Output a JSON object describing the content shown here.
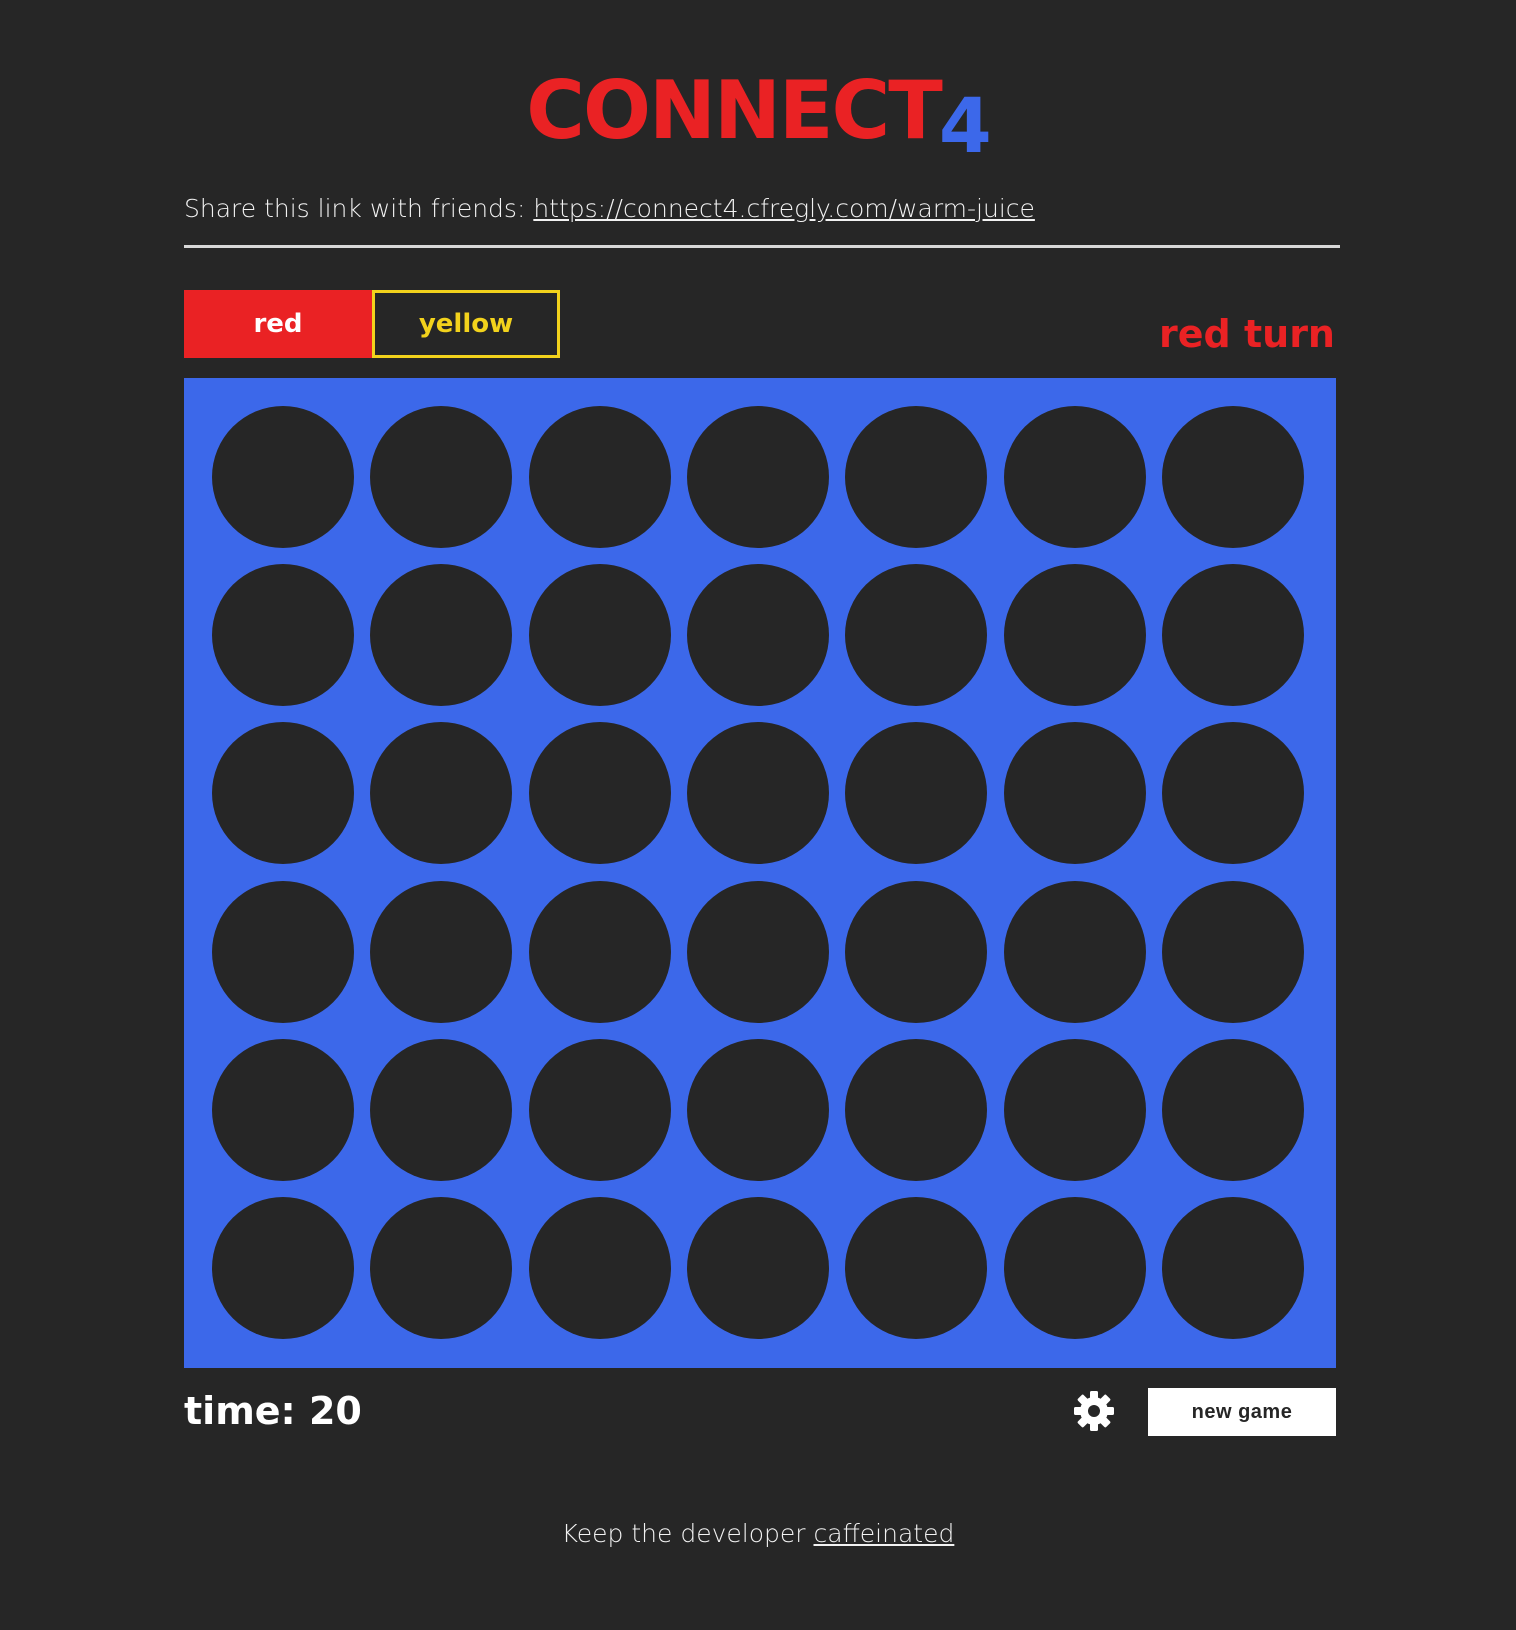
{
  "header": {
    "logo_word": "CONNECT",
    "logo_number": "4"
  },
  "share": {
    "label": "Share this link with friends:",
    "link": "https://connect4.cfregly.com/warm-juice"
  },
  "players": {
    "red_label": "red",
    "yellow_label": "yellow"
  },
  "status": {
    "turn": "red turn"
  },
  "board": {
    "rows": 6,
    "columns": 7,
    "cells": [
      [
        "empty",
        "empty",
        "empty",
        "empty",
        "empty",
        "empty",
        "empty"
      ],
      [
        "empty",
        "empty",
        "empty",
        "empty",
        "empty",
        "empty",
        "empty"
      ],
      [
        "empty",
        "empty",
        "empty",
        "empty",
        "empty",
        "empty",
        "empty"
      ],
      [
        "empty",
        "empty",
        "empty",
        "empty",
        "empty",
        "empty",
        "empty"
      ],
      [
        "empty",
        "empty",
        "empty",
        "empty",
        "empty",
        "empty",
        "empty"
      ],
      [
        "empty",
        "empty",
        "empty",
        "empty",
        "empty",
        "empty",
        "empty"
      ]
    ]
  },
  "timer": {
    "text": "time: 20"
  },
  "controls": {
    "settings_icon": "gear-icon",
    "new_game_label": "new game"
  },
  "footer": {
    "text": "Keep the developer",
    "link_text": "caffeinated"
  },
  "colors": {
    "background": "#262626",
    "red": "#ea2224",
    "yellow": "#f2d21c",
    "board_blue": "#3c68ea",
    "empty_slot": "#262626"
  }
}
